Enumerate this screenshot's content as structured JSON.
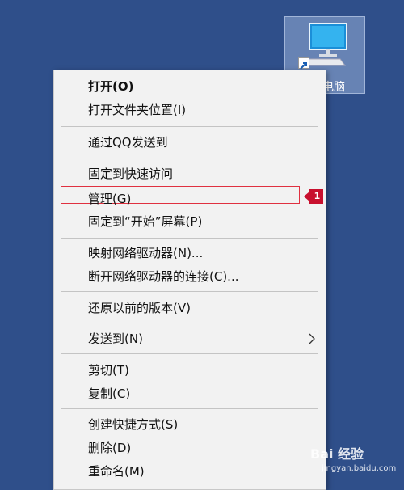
{
  "desktop_icon": {
    "label": "电脑",
    "icon": "computer-icon"
  },
  "menu": {
    "items": [
      {
        "label": "打开(O)"
      },
      {
        "label": "打开文件夹位置(I)"
      },
      {
        "label": "通过QQ发送到"
      },
      {
        "label": "固定到快速访问"
      },
      {
        "label": "管理(G)"
      },
      {
        "label": "固定到“开始”屏幕(P)"
      },
      {
        "label": "映射网络驱动器(N)..."
      },
      {
        "label": "断开网络驱动器的连接(C)..."
      },
      {
        "label": "还原以前的版本(V)"
      },
      {
        "label": "发送到(N)"
      },
      {
        "label": "剪切(T)"
      },
      {
        "label": "复制(C)"
      },
      {
        "label": "创建快捷方式(S)"
      },
      {
        "label": "删除(D)"
      },
      {
        "label": "重命名(M)"
      }
    ],
    "submenu_icon": "chevron-right-icon"
  },
  "callout": {
    "number": "1",
    "color": "#c8102e"
  },
  "watermark": {
    "brand": "Bai 经验",
    "url": "jingyan.baidu.com"
  }
}
